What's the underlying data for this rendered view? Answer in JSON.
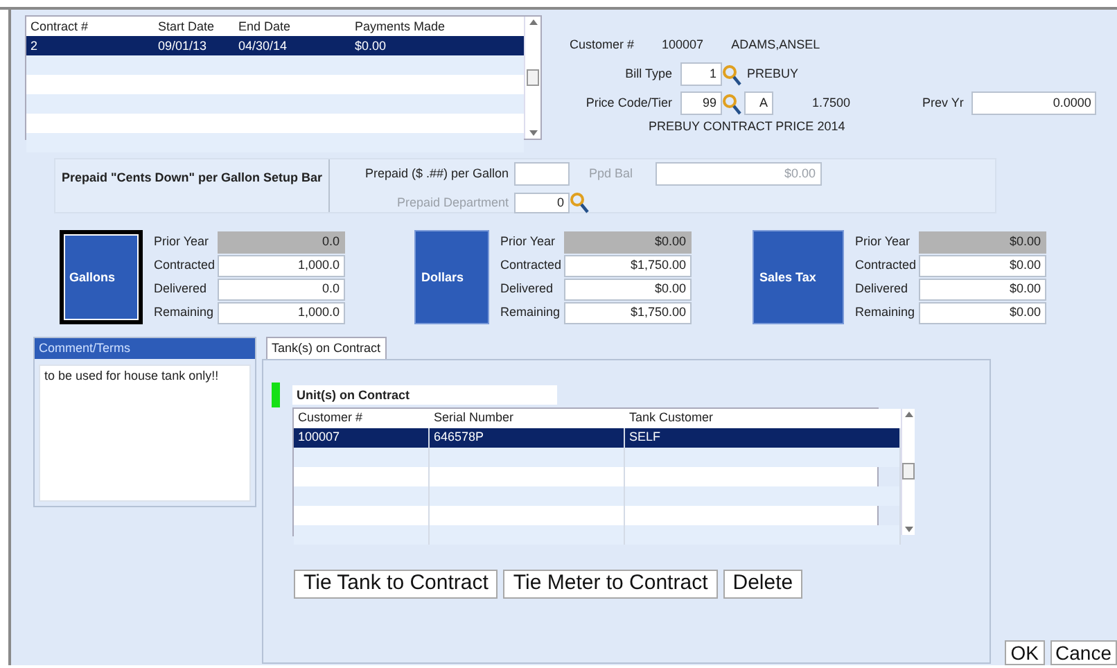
{
  "contracts": {
    "columns": [
      "Contract #",
      "Start Date",
      "End Date",
      "Payments Made"
    ],
    "rows": [
      {
        "cells": [
          "2",
          "09/01/13",
          "04/30/14",
          "$0.00"
        ],
        "selected": true
      }
    ]
  },
  "customer": {
    "label": "Customer #",
    "number": "100007",
    "name": "ADAMS,ANSEL"
  },
  "bill_type": {
    "label": "Bill Type",
    "value": "1",
    "description": "PREBUY"
  },
  "price_code": {
    "label": "Price Code/Tier",
    "value": "99",
    "tier": "A",
    "price": "1.7500",
    "prev_yr_label": "Prev Yr",
    "prev_yr": "0.0000",
    "description": "PREBUY CONTRACT PRICE 2014"
  },
  "prepaid": {
    "title": "Prepaid \"Cents Down\" per Gallon Setup Bar",
    "per_gallon_label": "Prepaid ($ .##) per Gallon",
    "balance_label": "Ppd Bal",
    "balance": "$0.00",
    "balance_disabled": true,
    "department_label": "Prepaid Department",
    "department": "0",
    "department_disabled": true
  },
  "totals": [
    {
      "title": "Gallons",
      "focused": true,
      "rows": [
        {
          "label": "Prior Year",
          "value": "0.0",
          "readonly": true
        },
        {
          "label": "Contracted",
          "value": "1,000.0",
          "readonly": false
        },
        {
          "label": "Delivered",
          "value": "0.0",
          "readonly": false
        },
        {
          "label": "Remaining",
          "value": "1,000.0",
          "readonly": false
        }
      ]
    },
    {
      "title": "Dollars",
      "focused": false,
      "rows": [
        {
          "label": "Prior Year",
          "value": "$0.00",
          "readonly": true
        },
        {
          "label": "Contracted",
          "value": "$1,750.00",
          "readonly": false
        },
        {
          "label": "Delivered",
          "value": "$0.00",
          "readonly": false
        },
        {
          "label": "Remaining",
          "value": "$1,750.00",
          "readonly": false
        }
      ]
    },
    {
      "title": "Sales Tax",
      "focused": false,
      "rows": [
        {
          "label": "Prior Year",
          "value": "$0.00",
          "readonly": true
        },
        {
          "label": "Contracted",
          "value": "$0.00",
          "readonly": false
        },
        {
          "label": "Delivered",
          "value": "$0.00",
          "readonly": false
        },
        {
          "label": "Remaining",
          "value": "$0.00",
          "readonly": false
        }
      ]
    }
  ],
  "comment": {
    "title": "Comment/Terms",
    "text": "to be used for house tank only!!"
  },
  "tabs": [
    {
      "label": "Tank(s) on Contract",
      "selected": true
    }
  ],
  "units": {
    "title": "Unit(s) on Contract",
    "columns": [
      "Customer #",
      "Serial Number",
      "Tank Customer"
    ],
    "rows": [
      {
        "cells": [
          "100007",
          "646578P",
          "SELF"
        ],
        "selected": true
      }
    ]
  },
  "buttons": [
    {
      "label": "Tie Tank to Contract"
    },
    {
      "label": "Tie Meter to Contract"
    },
    {
      "label": "Delete"
    }
  ],
  "dialog_buttons": [
    {
      "label": "OK"
    },
    {
      "label": "Cance"
    }
  ]
}
